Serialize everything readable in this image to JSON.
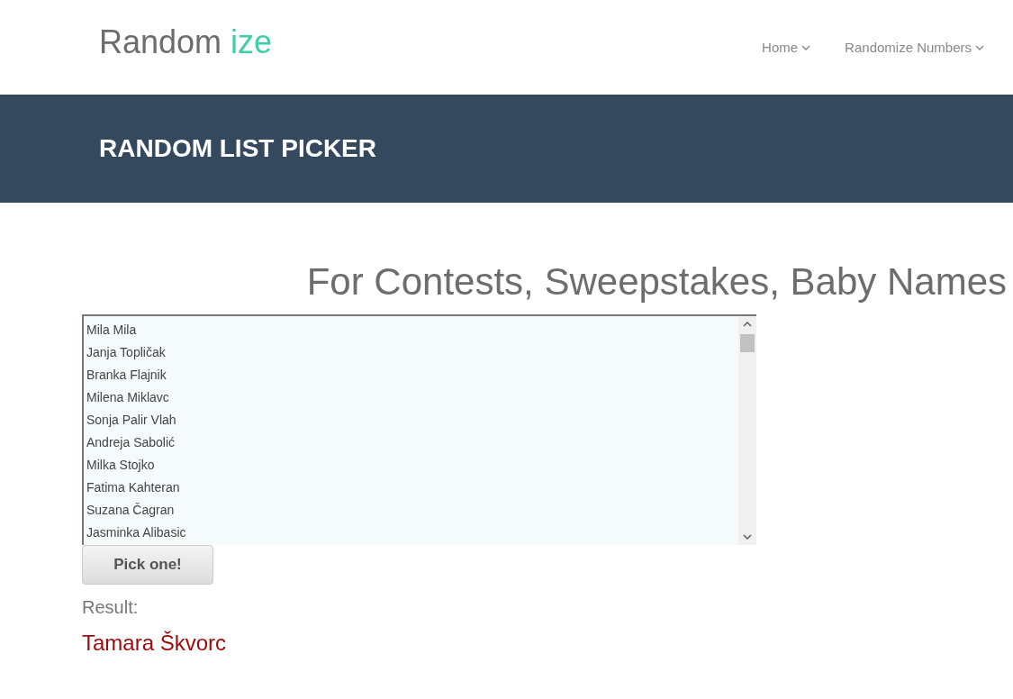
{
  "logo": {
    "main": "Random ",
    "accent": "ize"
  },
  "nav": [
    {
      "label": "Home"
    },
    {
      "label": "Randomize Numbers"
    }
  ],
  "banner": {
    "title": "RANDOM LIST PICKER"
  },
  "heading": "For Contests, Sweepstakes, Baby Names",
  "list": [
    "Mila Mila",
    "Janja Topličak",
    "Branka Flajnik",
    "Milena Miklavc",
    "Sonja Palir Vlah",
    "Andreja Sabolić",
    "Milka Stojko",
    "Fatima Kahteran",
    "Suzana Čagran",
    "Jasminka Alibasic"
  ],
  "button": "Pick one!",
  "result_label": "Result:",
  "result": "Tamara Škvorc"
}
